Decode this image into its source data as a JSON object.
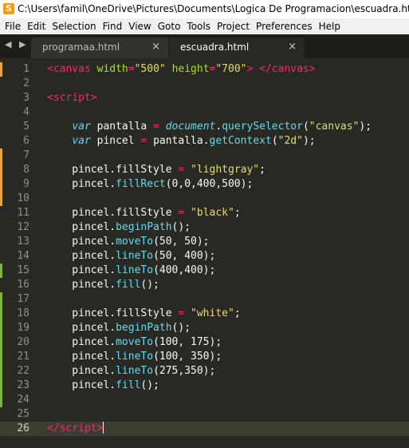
{
  "window": {
    "title": "C:\\Users\\famil\\OneDrive\\Pictures\\Documents\\Logica De Programacion\\escuadra.html - Sub",
    "icon": "sublime-text-icon"
  },
  "menu": [
    "File",
    "Edit",
    "Selection",
    "Find",
    "View",
    "Goto",
    "Tools",
    "Project",
    "Preferences",
    "Help"
  ],
  "tabs": {
    "nav": "◀ ▶",
    "items": [
      {
        "label": "programaa.html",
        "close": "×"
      },
      {
        "label": "escuadra.html",
        "close": "×"
      }
    ]
  },
  "colors": {
    "background": "#282923",
    "tag": "#f92672",
    "attribute": "#a6e22e",
    "string": "#e6db74",
    "keyword": "#66d9ef",
    "modified_marker": "#e5a445",
    "added_marker": "#7fb347"
  },
  "lines": [
    {
      "n": "1",
      "m": "modified",
      "t": [
        [
          "tg",
          "<canvas"
        ],
        [
          "pl",
          " "
        ],
        [
          "at",
          "width"
        ],
        [
          "op",
          "="
        ],
        [
          "st",
          "\"500\""
        ],
        [
          "pl",
          " "
        ],
        [
          "at",
          "height"
        ],
        [
          "op",
          "="
        ],
        [
          "st",
          "\"700\""
        ],
        [
          "tg",
          ">"
        ],
        [
          "pl",
          " "
        ],
        [
          "tg",
          "</canvas>"
        ]
      ]
    },
    {
      "n": "2",
      "t": []
    },
    {
      "n": "3",
      "t": [
        [
          "tg",
          "<script>"
        ]
      ]
    },
    {
      "n": "4",
      "t": []
    },
    {
      "n": "5",
      "t": [
        [
          "pl",
          "    "
        ],
        [
          "kw",
          "var"
        ],
        [
          "pl",
          " pantalla "
        ],
        [
          "op",
          "="
        ],
        [
          "pl",
          " "
        ],
        [
          "kw",
          "document"
        ],
        [
          "pl",
          "."
        ],
        [
          "fn",
          "querySelector"
        ],
        [
          "pl",
          "("
        ],
        [
          "st",
          "\"canvas\""
        ],
        [
          "pl",
          ");"
        ]
      ]
    },
    {
      "n": "6",
      "t": [
        [
          "pl",
          "    "
        ],
        [
          "kw",
          "var"
        ],
        [
          "pl",
          " pincel "
        ],
        [
          "op",
          "="
        ],
        [
          "pl",
          " pantalla."
        ],
        [
          "fn",
          "getContext"
        ],
        [
          "pl",
          "("
        ],
        [
          "st",
          "\"2d\""
        ],
        [
          "pl",
          ");"
        ]
      ]
    },
    {
      "n": "7",
      "m": "modified",
      "t": []
    },
    {
      "n": "8",
      "m": "modified",
      "t": [
        [
          "pl",
          "    pincel.fillStyle "
        ],
        [
          "op",
          "="
        ],
        [
          "pl",
          " "
        ],
        [
          "st",
          "\"lightgray\""
        ],
        [
          "pl",
          ";"
        ]
      ]
    },
    {
      "n": "9",
      "m": "modified",
      "t": [
        [
          "pl",
          "    pincel."
        ],
        [
          "fn",
          "fillRect"
        ],
        [
          "pl",
          "(0,0,400,500);"
        ]
      ]
    },
    {
      "n": "10",
      "m": "modified",
      "t": []
    },
    {
      "n": "11",
      "t": [
        [
          "pl",
          "    pincel.fillStyle "
        ],
        [
          "op",
          "="
        ],
        [
          "pl",
          " "
        ],
        [
          "st",
          "\"black\""
        ],
        [
          "pl",
          ";"
        ]
      ]
    },
    {
      "n": "12",
      "t": [
        [
          "pl",
          "    pincel."
        ],
        [
          "fn",
          "beginPath"
        ],
        [
          "pl",
          "();"
        ]
      ]
    },
    {
      "n": "13",
      "t": [
        [
          "pl",
          "    pincel."
        ],
        [
          "fn",
          "moveTo"
        ],
        [
          "pl",
          "(50, 50);"
        ]
      ]
    },
    {
      "n": "14",
      "t": [
        [
          "pl",
          "    pincel."
        ],
        [
          "fn",
          "lineTo"
        ],
        [
          "pl",
          "(50, 400);"
        ]
      ]
    },
    {
      "n": "15",
      "m": "added",
      "t": [
        [
          "pl",
          "    pincel."
        ],
        [
          "fn",
          "lineTo"
        ],
        [
          "pl",
          "(400,400);"
        ]
      ]
    },
    {
      "n": "16",
      "t": [
        [
          "pl",
          "    pincel."
        ],
        [
          "fn",
          "fill"
        ],
        [
          "pl",
          "();"
        ]
      ]
    },
    {
      "n": "17",
      "m": "added",
      "t": []
    },
    {
      "n": "18",
      "m": "added",
      "t": [
        [
          "pl",
          "    pincel.fillStyle "
        ],
        [
          "op",
          "="
        ],
        [
          "pl",
          " "
        ],
        [
          "st",
          "\"white\""
        ],
        [
          "pl",
          ";"
        ]
      ]
    },
    {
      "n": "19",
      "m": "added",
      "t": [
        [
          "pl",
          "    pincel."
        ],
        [
          "fn",
          "beginPath"
        ],
        [
          "pl",
          "();"
        ]
      ]
    },
    {
      "n": "20",
      "m": "added",
      "t": [
        [
          "pl",
          "    pincel."
        ],
        [
          "fn",
          "moveTo"
        ],
        [
          "pl",
          "(100, 175);"
        ]
      ]
    },
    {
      "n": "21",
      "m": "added",
      "t": [
        [
          "pl",
          "    pincel."
        ],
        [
          "fn",
          "lineTo"
        ],
        [
          "pl",
          "(100, 350);"
        ]
      ]
    },
    {
      "n": "22",
      "m": "added",
      "t": [
        [
          "pl",
          "    pincel."
        ],
        [
          "fn",
          "lineTo"
        ],
        [
          "pl",
          "(275,350);"
        ]
      ]
    },
    {
      "n": "23",
      "m": "added",
      "t": [
        [
          "pl",
          "    pincel."
        ],
        [
          "fn",
          "fill"
        ],
        [
          "pl",
          "();"
        ]
      ]
    },
    {
      "n": "24",
      "m": "added",
      "t": []
    },
    {
      "n": "25",
      "t": []
    },
    {
      "n": "26",
      "current": true,
      "t": [
        [
          "tg",
          "</"
        ],
        [
          "tg",
          "script"
        ],
        [
          "tg",
          ">"
        ]
      ]
    }
  ]
}
